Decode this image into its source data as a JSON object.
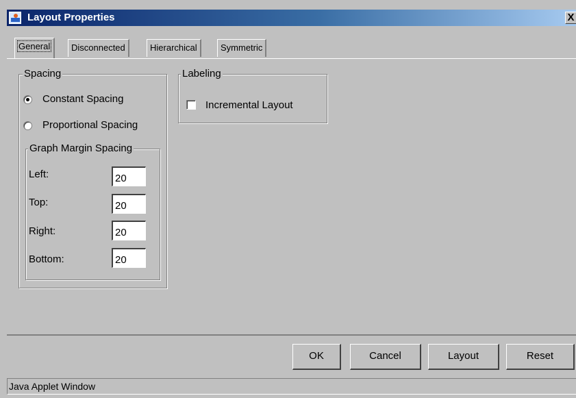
{
  "window": {
    "title": "Layout Properties",
    "close_label": "X"
  },
  "tabs": [
    {
      "label": "General",
      "active": true
    },
    {
      "label": "Disconnected",
      "active": false
    },
    {
      "label": "Hierarchical",
      "active": false
    },
    {
      "label": "Symmetric",
      "active": false
    }
  ],
  "spacing": {
    "legend": "Spacing",
    "options": [
      {
        "label": "Constant Spacing",
        "checked": true
      },
      {
        "label": "Proportional Spacing",
        "checked": false
      }
    ],
    "margin": {
      "legend": "Graph Margin Spacing",
      "fields": [
        {
          "label": "Left:",
          "value": "20"
        },
        {
          "label": "Top:",
          "value": "20"
        },
        {
          "label": "Right:",
          "value": "20"
        },
        {
          "label": "Bottom:",
          "value": "20"
        }
      ]
    }
  },
  "labeling": {
    "legend": "Labeling",
    "incremental_label": "Incremental Layout",
    "incremental_checked": false
  },
  "buttons": {
    "ok": "OK",
    "cancel": "Cancel",
    "layout": "Layout",
    "reset": "Reset"
  },
  "status": {
    "text": "Java Applet Window"
  }
}
